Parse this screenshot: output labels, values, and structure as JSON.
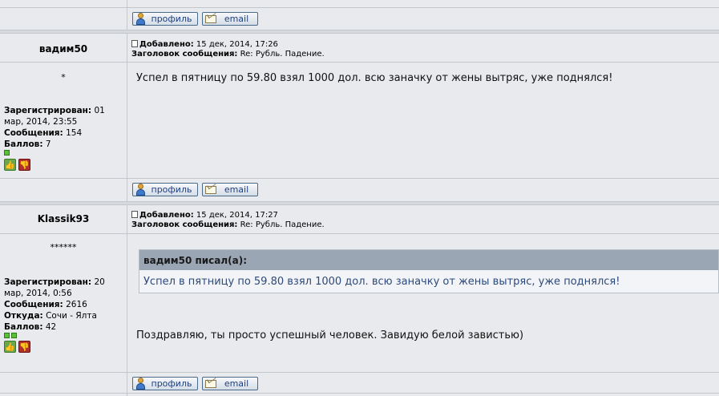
{
  "buttons": {
    "profile": "профиль",
    "email": "email"
  },
  "posts": [
    {
      "author": "вадим50",
      "rank": "*",
      "registered_label": "Зарегистрирован:",
      "registered": "01 мар, 2014, 23:55",
      "messages_label": "Сообщения:",
      "messages": "154",
      "points_label": "Баллов:",
      "points": "7",
      "added_label": "Добавлено:",
      "added": "15 дек, 2014, 17:26",
      "subject_label": "Заголовок сообщения:",
      "subject": "Re: Рубль. Падение.",
      "text": "Успел в пятницу по 59.80 взял 1000 дол. всю заначку от жены вытряс, уже поднялся!"
    },
    {
      "author": "Klassik93",
      "rank": "******",
      "registered_label": "Зарегистрирован:",
      "registered": "20 мар, 2014, 0:56",
      "messages_label": "Сообщения:",
      "messages": "2616",
      "from_label": "Откуда:",
      "from": "Сочи - Ялта",
      "points_label": "Баллов:",
      "points": "42",
      "added_label": "Добавлено:",
      "added": "15 дек, 2014, 17:27",
      "subject_label": "Заголовок сообщения:",
      "subject": "Re: Рубль. Падение.",
      "quote_header": "вадим50 писал(а):",
      "quote_text": "Успел в пятницу по 59.80 взял 1000 дол. всю заначку от жены вытряс, уже поднялся!",
      "text": "Поздравляю, ты просто успешный человек. Завидую белой завистью)"
    }
  ]
}
